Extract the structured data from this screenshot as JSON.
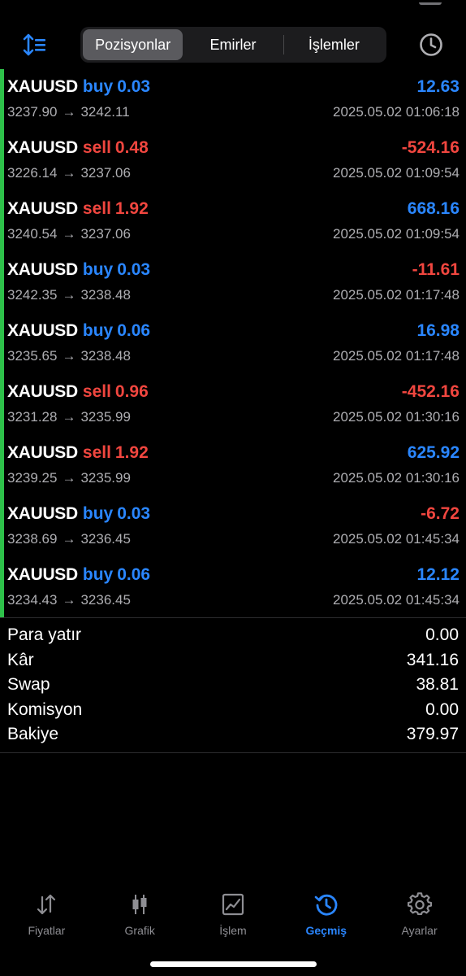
{
  "header": {
    "tabs": [
      {
        "label": "Pozisyonlar",
        "active": true
      },
      {
        "label": "Emirler",
        "active": false
      },
      {
        "label": "İşlemler",
        "active": false
      }
    ]
  },
  "colors": {
    "buy": "#2a86ff",
    "sell": "#f0463f",
    "accent_bar": "#2ec14a",
    "active_tab": "#2a86ff"
  },
  "positions": [
    {
      "symbol": "XAUUSD",
      "side": "buy",
      "volume": "0.03",
      "profit": "12.63",
      "open": "3237.90",
      "close": "3242.11",
      "time": "2025.05.02 01:06:18"
    },
    {
      "symbol": "XAUUSD",
      "side": "sell",
      "volume": "0.48",
      "profit": "-524.16",
      "open": "3226.14",
      "close": "3237.06",
      "time": "2025.05.02 01:09:54"
    },
    {
      "symbol": "XAUUSD",
      "side": "sell",
      "volume": "1.92",
      "profit": "668.16",
      "open": "3240.54",
      "close": "3237.06",
      "time": "2025.05.02 01:09:54"
    },
    {
      "symbol": "XAUUSD",
      "side": "buy",
      "volume": "0.03",
      "profit": "-11.61",
      "open": "3242.35",
      "close": "3238.48",
      "time": "2025.05.02 01:17:48"
    },
    {
      "symbol": "XAUUSD",
      "side": "buy",
      "volume": "0.06",
      "profit": "16.98",
      "open": "3235.65",
      "close": "3238.48",
      "time": "2025.05.02 01:17:48"
    },
    {
      "symbol": "XAUUSD",
      "side": "sell",
      "volume": "0.96",
      "profit": "-452.16",
      "open": "3231.28",
      "close": "3235.99",
      "time": "2025.05.02 01:30:16"
    },
    {
      "symbol": "XAUUSD",
      "side": "sell",
      "volume": "1.92",
      "profit": "625.92",
      "open": "3239.25",
      "close": "3235.99",
      "time": "2025.05.02 01:30:16"
    },
    {
      "symbol": "XAUUSD",
      "side": "buy",
      "volume": "0.03",
      "profit": "-6.72",
      "open": "3238.69",
      "close": "3236.45",
      "time": "2025.05.02 01:45:34"
    },
    {
      "symbol": "XAUUSD",
      "side": "buy",
      "volume": "0.06",
      "profit": "12.12",
      "open": "3234.43",
      "close": "3236.45",
      "time": "2025.05.02 01:45:34"
    }
  ],
  "arrow": "→",
  "summary": [
    {
      "label": "Para yatır",
      "value": "0.00"
    },
    {
      "label": "Kâr",
      "value": "341.16"
    },
    {
      "label": "Swap",
      "value": "38.81"
    },
    {
      "label": "Komisyon",
      "value": "0.00"
    },
    {
      "label": "Bakiye",
      "value": "379.97"
    }
  ],
  "tabbar": [
    {
      "label": "Fiyatlar",
      "icon": "arrows-updown-icon",
      "active": false
    },
    {
      "label": "Grafik",
      "icon": "candlestick-icon",
      "active": false
    },
    {
      "label": "İşlem",
      "icon": "trade-chart-icon",
      "active": false
    },
    {
      "label": "Geçmiş",
      "icon": "history-icon",
      "active": true
    },
    {
      "label": "Ayarlar",
      "icon": "gear-icon",
      "active": false
    }
  ]
}
